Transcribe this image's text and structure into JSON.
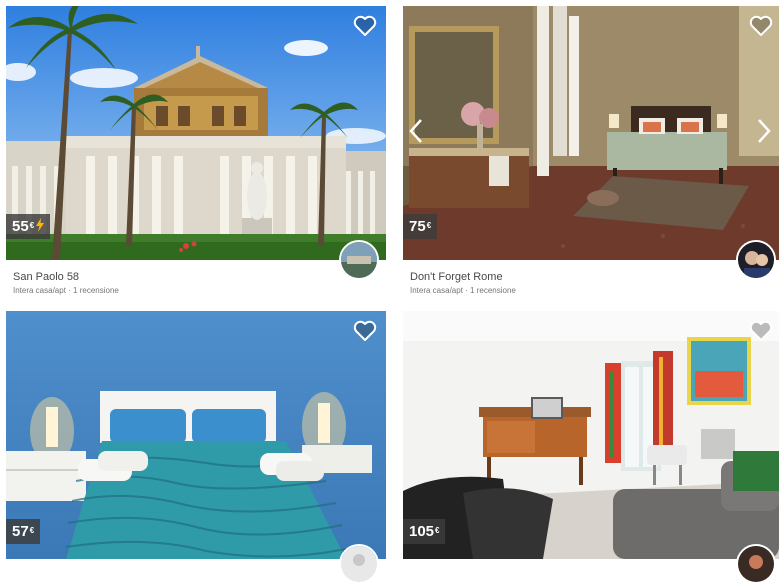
{
  "listings": [
    {
      "title": "San Paolo 58",
      "subtitle": "Intera casa/apt · 1 recensione",
      "price": "55",
      "currency": "€",
      "instant_book": true,
      "favorite_icon": "heart-outline-icon"
    },
    {
      "title": "Don't Forget Rome",
      "subtitle": "Intera casa/apt · 1 recensione",
      "price": "75",
      "currency": "€",
      "instant_book": false,
      "favorite_icon": "heart-outline-icon"
    },
    {
      "title": "",
      "subtitle": "",
      "price": "57",
      "currency": "€",
      "instant_book": false,
      "favorite_icon": "heart-outline-icon"
    },
    {
      "title": "",
      "subtitle": "",
      "price": "105",
      "currency": "€",
      "instant_book": false,
      "favorite_icon": "heart-outline-icon"
    }
  ],
  "colors": {
    "price_badge": "#3c3c3c",
    "instant_book_bolt": "#ffb400",
    "title_text": "#484848",
    "subtitle_text": "#767676"
  }
}
